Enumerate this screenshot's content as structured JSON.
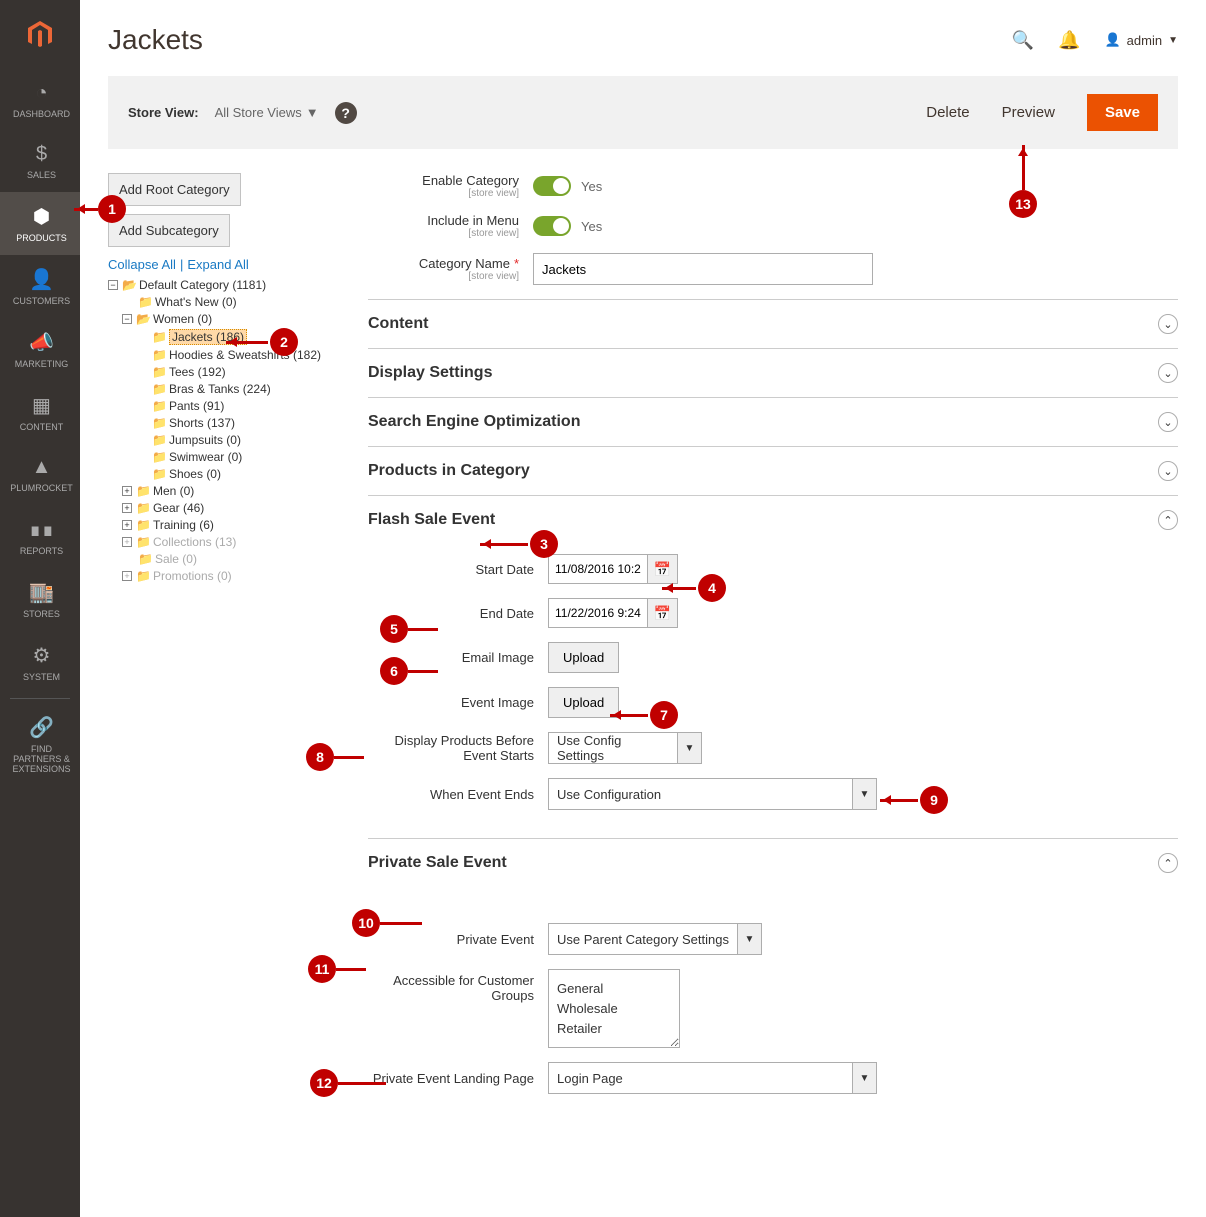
{
  "sidebar": {
    "items": [
      {
        "label": "DASHBOARD"
      },
      {
        "label": "SALES"
      },
      {
        "label": "PRODUCTS"
      },
      {
        "label": "CUSTOMERS"
      },
      {
        "label": "MARKETING"
      },
      {
        "label": "CONTENT"
      },
      {
        "label": "PLUMROCKET"
      },
      {
        "label": "REPORTS"
      },
      {
        "label": "STORES"
      },
      {
        "label": "SYSTEM"
      },
      {
        "label": "FIND PARTNERS & EXTENSIONS"
      }
    ]
  },
  "header": {
    "title": "Jackets",
    "user": "admin"
  },
  "toolbar": {
    "storeview_label": "Store View:",
    "storeview_value": "All Store Views",
    "delete": "Delete",
    "preview": "Preview",
    "save": "Save"
  },
  "tree_buttons": {
    "add_root": "Add Root Category",
    "add_sub": "Add Subcategory",
    "collapse": "Collapse All",
    "expand": "Expand All"
  },
  "tree": {
    "root": "Default Category (1181)",
    "whats_new": "What's New (0)",
    "women": "Women (0)",
    "women_children": [
      "Jackets (186)",
      "Hoodies & Sweatshirts (182)",
      "Tees (192)",
      "Bras & Tanks (224)",
      "Pants (91)",
      "Shorts (137)",
      "Jumpsuits (0)",
      "Swimwear (0)",
      "Shoes (0)"
    ],
    "men": "Men (0)",
    "gear": "Gear (46)",
    "training": "Training (6)",
    "collections": "Collections (13)",
    "sale": "Sale (0)",
    "promotions": "Promotions (0)"
  },
  "general": {
    "enable_label": "Enable Category",
    "enable_scope": "[store view]",
    "enable_value": "Yes",
    "menu_label": "Include in Menu",
    "menu_scope": "[store view]",
    "menu_value": "Yes",
    "name_label": "Category Name",
    "name_scope": "[store view]",
    "name_value": "Jackets"
  },
  "sections": {
    "content": "Content",
    "display": "Display Settings",
    "seo": "Search Engine Optimization",
    "products": "Products in Category",
    "flash": "Flash Sale Event",
    "private": "Private Sale Event"
  },
  "flash": {
    "start_label": "Start Date",
    "start_value": "11/08/2016 10:2",
    "end_label": "End Date",
    "end_value": "11/22/2016 9:24",
    "email_img_label": "Email Image",
    "event_img_label": "Event Image",
    "upload_label": "Upload",
    "display_before_label": "Display Products Before Event Starts",
    "display_before_value": "Use Config Settings",
    "when_ends_label": "When Event Ends",
    "when_ends_value": "Use Configuration"
  },
  "private": {
    "private_event_label": "Private Event",
    "private_event_value": "Use Parent Category Settings",
    "groups_label": "Accessible for Customer Groups",
    "groups": [
      "General",
      "Wholesale",
      "Retailer"
    ],
    "landing_label": "Private Event Landing Page",
    "landing_value": "Login Page"
  },
  "callouts": {
    "c1": "1",
    "c2": "2",
    "c3": "3",
    "c4": "4",
    "c5": "5",
    "c6": "6",
    "c7": "7",
    "c8": "8",
    "c9": "9",
    "c10": "10",
    "c11": "11",
    "c12": "12",
    "c13": "13"
  }
}
